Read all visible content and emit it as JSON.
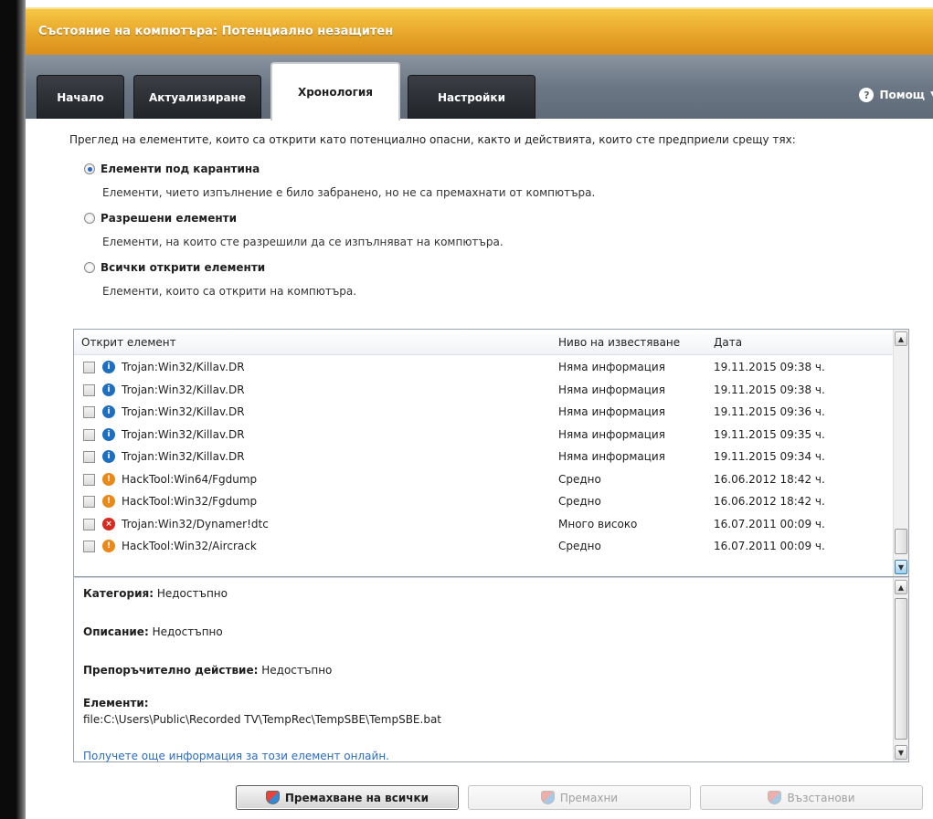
{
  "window": {
    "title": "Състояние на компютъра: Потенциално незащитен"
  },
  "tabs": [
    {
      "label": "Начало",
      "active": false
    },
    {
      "label": "Актуализиране",
      "active": false
    },
    {
      "label": "Хронология",
      "active": true
    },
    {
      "label": "Настройки",
      "active": false
    }
  ],
  "help": {
    "label": "Помощ"
  },
  "intro": "Преглед на елементите, които са открити като потенциално опасни, както и действията, които сте предприели срещу тях:",
  "options": [
    {
      "label": "Елементи под карантина",
      "desc": "Елементи, чието изпълнение е било забранено, но не са премахнати от компютъра.",
      "checked": true
    },
    {
      "label": "Разрешени елементи",
      "desc": "Елементи, на които сте разрешили да се изпълняват на компютъра.",
      "checked": false
    },
    {
      "label": "Всички открити елементи",
      "desc": "Елементи, които са открити на компютъра.",
      "checked": false
    }
  ],
  "list": {
    "columns": [
      "Открит елемент",
      "Ниво на известяване",
      "Дата"
    ],
    "rows": [
      {
        "name": "Trojan:Win32/Killav.DR",
        "level": "Няма информация",
        "date": "19.11.2015 09:38 ч.",
        "icon": "info-icon",
        "icon_color": "#1e6fc0"
      },
      {
        "name": "Trojan:Win32/Killav.DR",
        "level": "Няма информация",
        "date": "19.11.2015 09:38 ч.",
        "icon": "info-icon",
        "icon_color": "#1e6fc0"
      },
      {
        "name": "Trojan:Win32/Killav.DR",
        "level": "Няма информация",
        "date": "19.11.2015 09:36 ч.",
        "icon": "info-icon",
        "icon_color": "#1e6fc0"
      },
      {
        "name": "Trojan:Win32/Killav.DR",
        "level": "Няма информация",
        "date": "19.11.2015 09:35 ч.",
        "icon": "info-icon",
        "icon_color": "#1e6fc0"
      },
      {
        "name": "Trojan:Win32/Killav.DR",
        "level": "Няма информация",
        "date": "19.11.2015 09:34 ч.",
        "icon": "info-icon",
        "icon_color": "#1e6fc0"
      },
      {
        "name": "HackTool:Win64/Fgdump",
        "level": "Средно",
        "date": "16.06.2012 18:42 ч.",
        "icon": "warning-icon",
        "icon_color": "#e8891a"
      },
      {
        "name": "HackTool:Win32/Fgdump",
        "level": "Средно",
        "date": "16.06.2012 18:42 ч.",
        "icon": "warning-icon",
        "icon_color": "#e8891a"
      },
      {
        "name": "Trojan:Win32/Dynamer!dtc",
        "level": "Много високо",
        "date": "16.07.2011 00:09 ч.",
        "icon": "severe-icon",
        "icon_color": "#d42a20"
      },
      {
        "name": "HackTool:Win32/Aircrack",
        "level": "Средно",
        "date": "16.07.2011 00:09 ч.",
        "icon": "warning-icon",
        "icon_color": "#e8891a"
      }
    ]
  },
  "details": {
    "category_label": "Категория:",
    "category_value": "Недостъпно",
    "description_label": "Описание:",
    "description_value": "Недостъпно",
    "action_label": "Препоръчително действие:",
    "action_value": "Недостъпно",
    "items_label": "Елементи:",
    "items_value": "file:C:\\Users\\Public\\Recorded TV\\TempRec\\TempSBE\\TempSBE.bat",
    "more_link": "Получете още информация за този елемент онлайн."
  },
  "buttons": {
    "remove_all": "Премахване на всички",
    "remove": "Премахни",
    "restore": "Възстанови"
  }
}
